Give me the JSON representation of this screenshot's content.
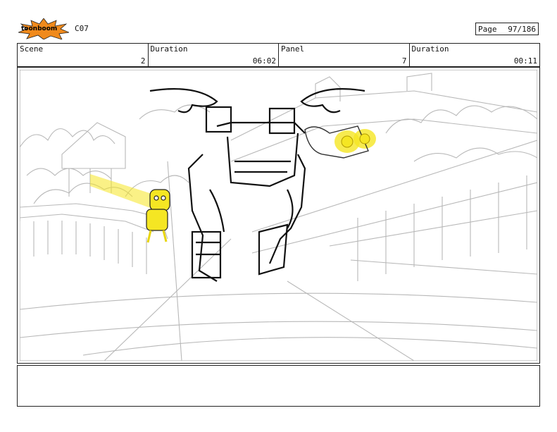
{
  "header": {
    "logo_text": "toonboom",
    "code": "C07",
    "page_label": "Page",
    "page_value": "97/186"
  },
  "info": {
    "scene_label": "Scene",
    "scene_value": "2",
    "duration_label": "Duration",
    "duration_value": "06:02",
    "panel_label": "Panel",
    "panel_value": "7",
    "panel_duration_label": "Duration",
    "panel_duration_value": "00:11"
  },
  "notes": {
    "text": ""
  },
  "colors": {
    "highlight": "#f5e623",
    "sketch": "#b8b8b8",
    "ink": "#111111",
    "logo_orange": "#f08a1c"
  }
}
